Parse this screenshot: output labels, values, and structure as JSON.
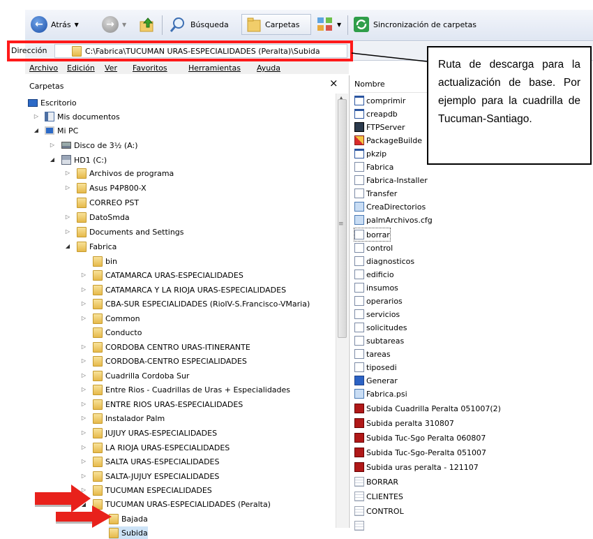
{
  "toolbar": {
    "back_label": "Atrás",
    "search_label": "Búsqueda",
    "folders_label": "Carpetas",
    "sync_label": "Sincronización de carpetas"
  },
  "address": {
    "label": "Dirección",
    "value": "C:\\Fabrica\\TUCUMAN URAS-ESPECIALIDADES (Peralta)\\Subida"
  },
  "menu": {
    "items": [
      "Archivo",
      "Edición",
      "Ver",
      "Favoritos",
      "Herramientas",
      "Ayuda"
    ]
  },
  "folders_pane": {
    "title": "Carpetas",
    "close_glyph": "×"
  },
  "tree": {
    "desktop": "Escritorio",
    "my_documents": "Mis documentos",
    "my_pc": "Mi PC",
    "floppy": "Disco de 3½ (A:)",
    "hd1": "HD1 (C:)",
    "c_children": [
      "Archivos de programa",
      "Asus P4P800-X",
      "CORREO PST",
      "DatoSmda",
      "Documents and Settings",
      "Fabrica"
    ],
    "fabrica_children": [
      "bin",
      "CATAMARCA URAS-ESPECIALIDADES",
      "CATAMARCA Y LA RIOJA URAS-ESPECIALIDADES",
      "CBA-SUR ESPECIALIDADES (RioIV-S.Francisco-VMaria)",
      "Common",
      "Conducto",
      "CORDOBA CENTRO URAS-ITINERANTE",
      "CORDOBA-CENTRO ESPECIALIDADES",
      "Cuadrilla Cordoba Sur",
      "Entre Rios - Cuadrillas de Uras + Especialidades",
      "ENTRE RIOS URAS-ESPECIALIDADES",
      "Instalador Palm",
      "JUJUY URAS-ESPECIALIDADES",
      "LA RIOJA URAS-ESPECIALIDADES",
      "SALTA URAS-ESPECIALIDADES",
      "SALTA-JUJUY ESPECIALIDADES",
      "TUCUMAN ESPECIALIDADES",
      "TUCUMAN URAS-ESPECIALIDADES (Peralta)"
    ],
    "tucuman_children": [
      "Bajada",
      "Subida"
    ]
  },
  "file_list": {
    "header": "Nombre",
    "files": [
      "comprimir",
      "creapdb",
      "FTPServer",
      "PackageBuilde",
      "pkzip",
      "Fabrica",
      "Fabrica-Installer",
      "Transfer",
      "CreaDirectorios",
      "palmArchivos.cfg",
      "borrar",
      "control",
      "diagnosticos",
      "edificio",
      "insumos",
      "operarios",
      "servicios",
      "solicitudes",
      "subtareas",
      "tareas",
      "tiposedi",
      "Generar",
      "Fabrica.psi",
      "Subida Cuadrilla Peralta 051007(2)",
      "Subida peralta 310807",
      "Subida Tuc-Sgo Peralta 060807",
      "Subida Tuc-Sgo-Peralta 051007",
      "Subida uras peralta - 121107",
      "BORRAR",
      "CLIENTES",
      "CONTROL"
    ]
  },
  "callout": {
    "text": "Ruta de descarga para la actualización de base. Por ejemplo para la cuadrilla de Tucuman-Santiago."
  },
  "colors": {
    "highlight_red": "#ff1a1a",
    "arrow_red": "#e8211b",
    "folder_yellow": "#f1cd6a"
  }
}
